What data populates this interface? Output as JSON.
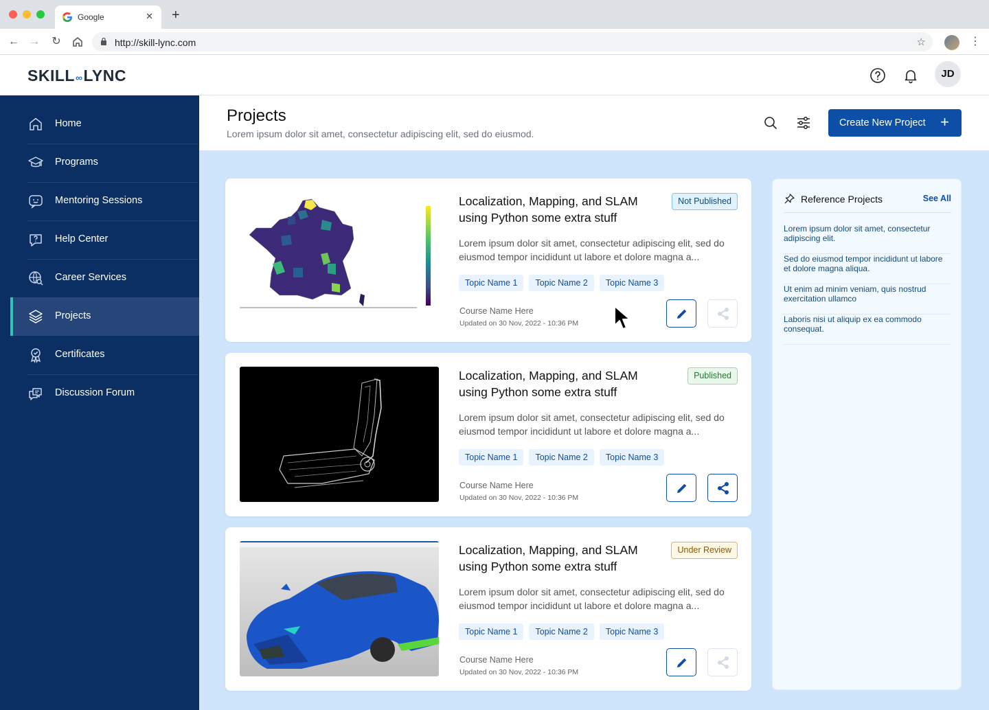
{
  "browser": {
    "tab_title": "Google",
    "url": "http://skill-lync.com"
  },
  "header": {
    "logo_left": "SKILL",
    "logo_right": "LYNC",
    "avatar_initials": "JD"
  },
  "sidebar": {
    "items": [
      {
        "label": "Home",
        "icon": "home-icon"
      },
      {
        "label": "Programs",
        "icon": "graduation-cap-icon"
      },
      {
        "label": "Mentoring Sessions",
        "icon": "chat-smile-icon"
      },
      {
        "label": "Help Center",
        "icon": "help-chat-icon"
      },
      {
        "label": "Career Services",
        "icon": "globe-search-icon"
      },
      {
        "label": "Projects",
        "icon": "layers-icon",
        "active": true
      },
      {
        "label": "Certificates",
        "icon": "certificate-icon"
      },
      {
        "label": "Discussion Forum",
        "icon": "discussion-icon"
      }
    ],
    "active_color": "#2ec4b6"
  },
  "page": {
    "title": "Projects",
    "subtitle": "Lorem ipsum dolor sit amet, consectetur adipiscing elit, sed do eiusmod.",
    "create_button": "Create New Project",
    "create_plus": "+"
  },
  "projects": [
    {
      "title": "Localization, Mapping, and SLAM using Python some extra stuff",
      "status": "Not Published",
      "description": "Lorem ipsum dolor sit amet, consectetur adipiscing elit, sed do eiusmod tempor incididunt ut labore et dolore magna a...",
      "topics": [
        "Topic Name 1",
        "Topic Name 2",
        "Topic Name 3"
      ],
      "course": "Course Name Here",
      "updated": "Updated on 30 Nov, 2022 - 10:36 PM",
      "share_enabled": false,
      "thumbnail": "france-map"
    },
    {
      "title": "Localization, Mapping, and SLAM using Python some extra stuff",
      "status": "Published",
      "description": "Lorem ipsum dolor sit amet, consectetur adipiscing elit, sed do eiusmod tempor incididunt ut labore et dolore magna a...",
      "topics": [
        "Topic Name 1",
        "Topic Name 2",
        "Topic Name 3"
      ],
      "course": "Course Name Here",
      "updated": "Updated on 30 Nov, 2022 - 10:36 PM",
      "share_enabled": true,
      "thumbnail": "seat-wireframe"
    },
    {
      "title": "Localization, Mapping, and SLAM using Python some extra stuff",
      "status": "Under Review",
      "description": "Lorem ipsum dolor sit amet, consectetur adipiscing elit, sed do eiusmod tempor incididunt ut labore et dolore magna a...",
      "topics": [
        "Topic Name 1",
        "Topic Name 2",
        "Topic Name 3"
      ],
      "course": "Course Name Here",
      "updated": "Updated on 30 Nov, 2022 - 10:36 PM",
      "share_enabled": false,
      "thumbnail": "blue-car-cad"
    }
  ],
  "reference": {
    "title": "Reference Projects",
    "see_all": "See All",
    "items": [
      "Lorem ipsum dolor sit amet, consectetur adipiscing elit.",
      "Sed do eiusmod tempor incididunt ut labore et dolore magna aliqua.",
      "Ut enim ad minim veniam, quis nostrud exercitation ullamco",
      "Laboris nisi ut aliquip ex ea commodo consequat."
    ]
  },
  "colors": {
    "sidebar": "#0c2f63",
    "primary": "#0d4ea6",
    "content_bg": "#cfe5fb"
  }
}
